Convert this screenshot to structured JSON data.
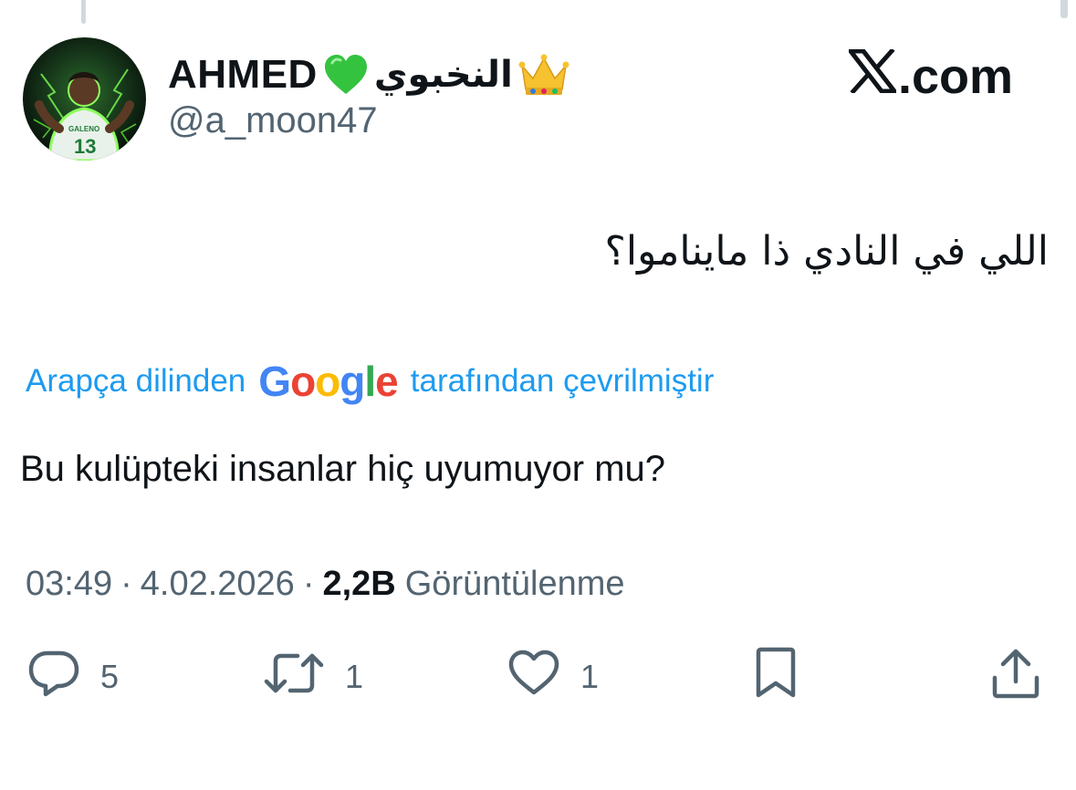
{
  "tweet": {
    "author": {
      "display_name": "AHMED",
      "display_name_arabic": "النخبوي",
      "handle": "@a_moon47",
      "avatar_icon": "avatar-player-green-lightning",
      "badge_icons": [
        "green-heart-icon",
        "crown-icon"
      ],
      "jersey_number": "13"
    },
    "brand": {
      "label": ".com",
      "logo_icon": "x-logo-icon"
    },
    "original_text": "اللي في النادي ذا مايناموا؟",
    "translation": {
      "prefix": "Arapça dilinden",
      "provider": "Google",
      "suffix": "tarafından çevrilmiştir",
      "text": "Bu kulüpteki insanlar hiç uyumuyor mu?"
    },
    "meta": {
      "time": "03:49",
      "separator": "·",
      "date": "4.02.2026",
      "views_count": "2,2B",
      "views_label": "Görüntülenme"
    },
    "actions": {
      "replies": "5",
      "retweets": "1",
      "likes": "1"
    },
    "colors": {
      "link_blue": "#1d9bf0",
      "secondary_text": "#536471",
      "primary_text": "#0f1419",
      "google_blue": "#4285F4",
      "google_red": "#EA4335",
      "google_yellow": "#FBBC05",
      "google_green": "#34A853"
    }
  }
}
